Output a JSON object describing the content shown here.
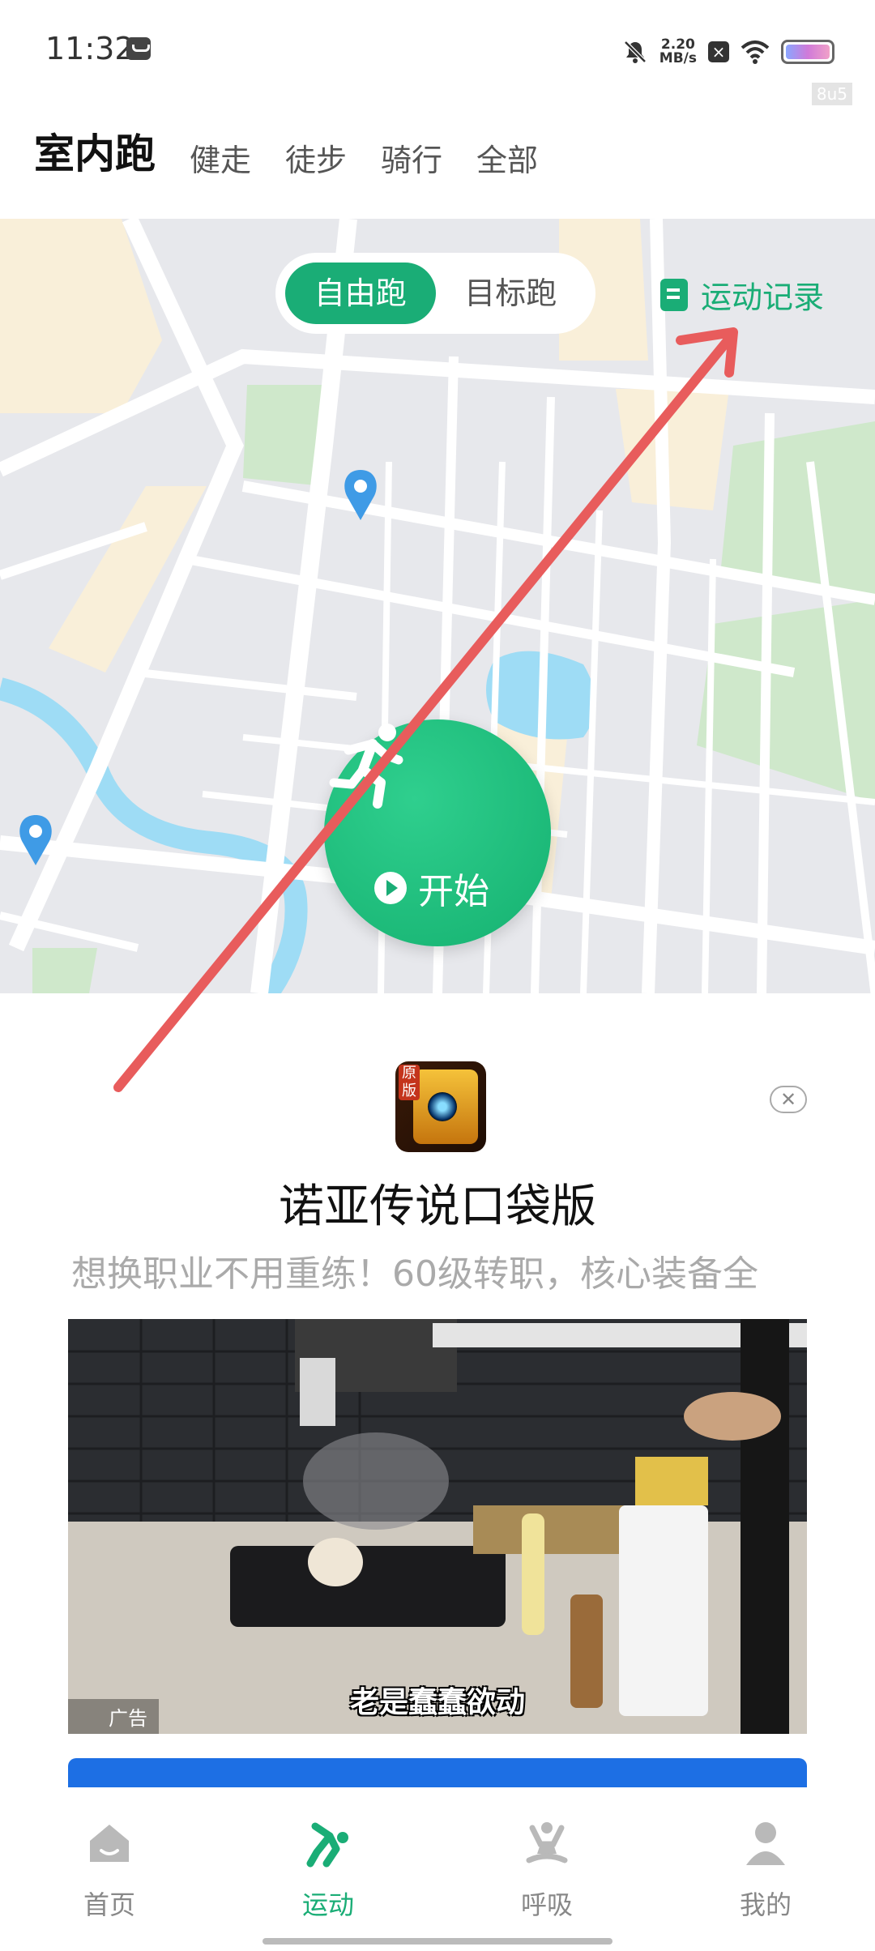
{
  "status_bar": {
    "time": "11:32",
    "net_speed_value": "2.20",
    "net_speed_unit": "MB/s",
    "x_badge": "×",
    "device_tag": "8u5"
  },
  "top_tabs": [
    {
      "label": "室内跑",
      "active": true
    },
    {
      "label": "健走",
      "active": false
    },
    {
      "label": "徒步",
      "active": false
    },
    {
      "label": "骑行",
      "active": false
    },
    {
      "label": "全部",
      "active": false
    }
  ],
  "mode_toggle": {
    "free_run": "自由跑",
    "target_run": "目标跑",
    "selected": "自由跑"
  },
  "record_link": "运动记录",
  "start_button": {
    "label": "开始"
  },
  "ad": {
    "app_badge": "原版",
    "title": "诺亚传说口袋版",
    "description": "想换职业不用重练！60级转职，核心装备全",
    "video_caption": "老是蠢蠢欲动",
    "tag": "广告",
    "close_symbol": "✕"
  },
  "bottom_nav": [
    {
      "label": "首页",
      "icon": "home-icon",
      "active": false
    },
    {
      "label": "运动",
      "icon": "workout-icon",
      "active": true
    },
    {
      "label": "呼吸",
      "icon": "breathe-icon",
      "active": false
    },
    {
      "label": "我的",
      "icon": "profile-icon",
      "active": false
    }
  ],
  "colors": {
    "accent": "#1aad76",
    "arrow": "#e85c5c",
    "cta": "#1d6fe4"
  }
}
